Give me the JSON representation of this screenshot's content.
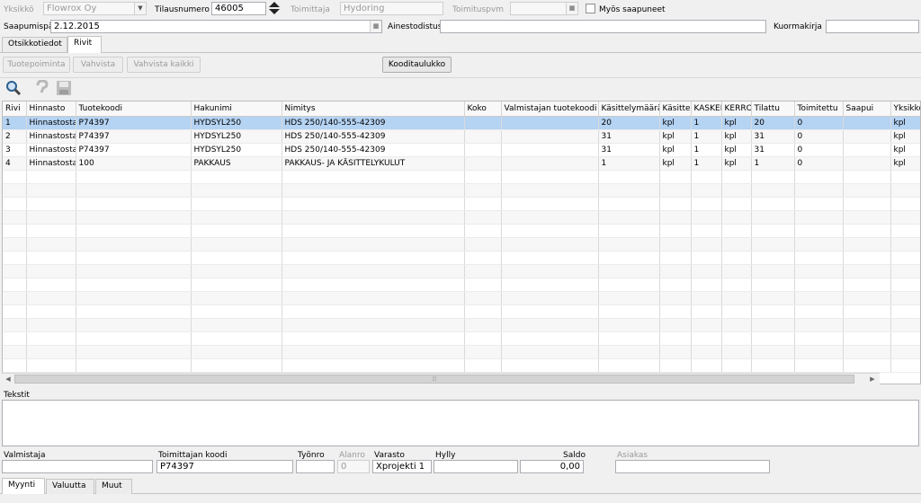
{
  "header": {
    "yksikko_label": "Yksikkö",
    "yksikko_value": "Flowrox Oy",
    "tilausnumero_label": "Tilausnumero",
    "tilausnumero_value": "46005",
    "toimittaja_label": "Toimittaja",
    "toimittaja_value": "Hydoring",
    "toimituspvm_label": "Toimituspvm",
    "toimituspvm_value": "",
    "myos_saapuneet_label": "Myös saapuneet",
    "saapumispaiva_label": "Saapumispäivä",
    "saapumispaiva_value": "2.12.2015",
    "ainestodistus_label": "Ainestodistus",
    "ainestodistus_value": "",
    "kuormakirja_label": "Kuormakirja",
    "kuormakirja_value": ""
  },
  "top_tabs": [
    {
      "label": "Otsikkotiedot",
      "active": false
    },
    {
      "label": "Rivit",
      "active": true
    }
  ],
  "buttons": {
    "tuotepoiminta": "Tuotepoiminta",
    "vahvista": "Vahvista",
    "vahvista_kaikki": "Vahvista kaikki",
    "kooditaulukko": "Kooditaulukko"
  },
  "toolbar_icons": [
    "search-icon",
    "help-icon",
    "save-icon"
  ],
  "grid": {
    "columns": [
      "Rivi",
      "Hinnasto",
      "Tuotekoodi",
      "Hakunimi",
      "Nimitys",
      "Koko",
      "Valmistajan tuotekoodi",
      "Käsittelymäärä",
      "Käsitte",
      "KASKEI",
      "KERRO",
      "Tilattu",
      "Toimitettu",
      "Saapui",
      "Yksikkö"
    ],
    "rows": [
      [
        "1",
        "Hinnastosta",
        "P74397",
        "HYDSYL250",
        "HDS 250/140-555-42309",
        "",
        "",
        "20",
        "kpl",
        "1",
        "kpl",
        "20",
        "0",
        "",
        "kpl"
      ],
      [
        "2",
        "Hinnastosta",
        "P74397",
        "HYDSYL250",
        "HDS 250/140-555-42309",
        "",
        "",
        "31",
        "kpl",
        "1",
        "kpl",
        "31",
        "0",
        "",
        "kpl"
      ],
      [
        "3",
        "Hinnastosta",
        "P74397",
        "HYDSYL250",
        "HDS 250/140-555-42309",
        "",
        "",
        "31",
        "kpl",
        "1",
        "kpl",
        "31",
        "0",
        "",
        "kpl"
      ],
      [
        "4",
        "Hinnastosta",
        "100",
        "PAKKAUS",
        "PAKKAUS- JA KÄSITTELYKULUT",
        "",
        "",
        "1",
        "kpl",
        "1",
        "kpl",
        "1",
        "0",
        "",
        "kpl"
      ]
    ],
    "selected_row": 0
  },
  "tekstit_label": "Tekstit",
  "tekstit_value": "",
  "bottom": {
    "valmistaja_label": "Valmistaja",
    "valmistaja_value": "",
    "toimittajan_koodi_label": "Toimittajan koodi",
    "toimittajan_koodi_value": "P74397",
    "tyonro_label": "Työnro",
    "tyonro_value": "",
    "alanro_label": "Alanro",
    "alanro_value": "0",
    "varasto_label": "Varasto",
    "varasto_value": "Xprojekti 1",
    "hylly_label": "Hylly",
    "hylly_value": "",
    "saldo_label": "Saldo",
    "saldo_value": "0,00",
    "asiakas_label": "Asiakas",
    "asiakas_value": ""
  },
  "bottom_tabs": [
    {
      "label": "Myynti",
      "active": true
    },
    {
      "label": "Valuutta",
      "active": false
    },
    {
      "label": "Muut",
      "active": false
    }
  ]
}
